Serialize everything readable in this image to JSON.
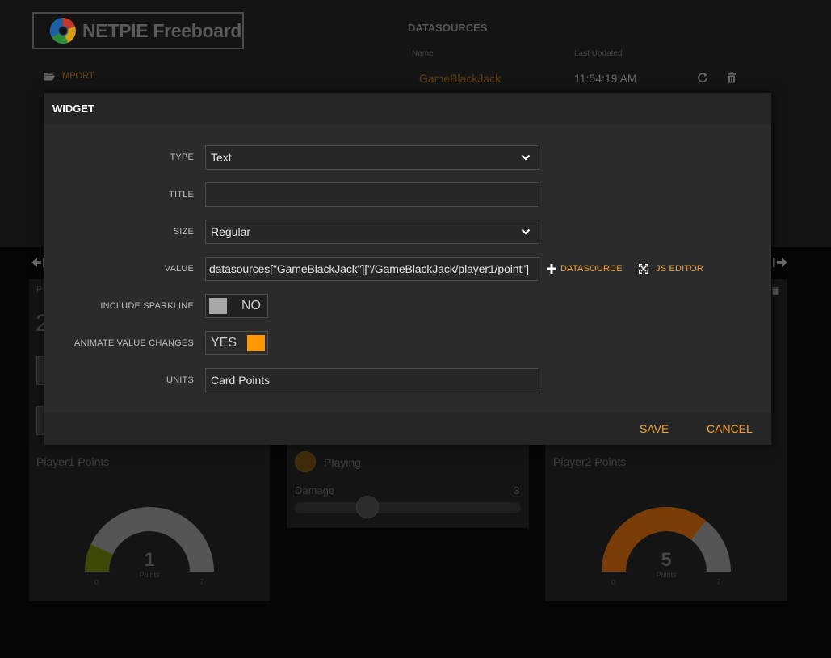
{
  "app": {
    "title": "NETPIE Freeboard"
  },
  "header": {
    "import_label": "IMPORT",
    "datasources": {
      "heading": "DATASOURCES",
      "columns": [
        "Name",
        "Last Updated"
      ],
      "rows": [
        {
          "name": "GameBlackJack",
          "last_updated": "11:54:19 AM"
        }
      ]
    }
  },
  "panes": {
    "left": {
      "title": "Player1 Points",
      "gauge": {
        "value": "1",
        "units": "Points",
        "min": "0",
        "max": "7",
        "fraction": 0.14
      }
    },
    "middle": {
      "indicator_label": "Playing",
      "slider_label": "Damage",
      "slider_value": "3",
      "slider_fraction": 0.32
    },
    "right": {
      "title": "Player2 Points",
      "gauge": {
        "value": "5",
        "units": "Points",
        "min": "0",
        "max": "7",
        "fraction": 0.71
      }
    },
    "left_partial_value": "2",
    "left_partial_title": "P"
  },
  "modal": {
    "title": "WIDGET",
    "fields": {
      "type": {
        "label": "TYPE",
        "value": "Text"
      },
      "title": {
        "label": "TITLE",
        "value": ""
      },
      "size": {
        "label": "SIZE",
        "value": "Regular"
      },
      "value": {
        "label": "VALUE",
        "value": "datasources[\"GameBlackJack\"][\"/GameBlackJack/player1/point\"]"
      },
      "sparkline": {
        "label": "INCLUDE SPARKLINE",
        "state": "NO"
      },
      "animate": {
        "label": "ANIMATE VALUE CHANGES",
        "state": "YES"
      },
      "units": {
        "label": "UNITS",
        "value": "Card Points"
      }
    },
    "actions": {
      "datasource": "DATASOURCE",
      "js_editor": "JS EDITOR"
    },
    "footer": {
      "save": "SAVE",
      "cancel": "CANCEL"
    }
  },
  "colors": {
    "accent": "#f0a43a",
    "toggle_on": "#ff9800",
    "toggle_off": "#a8a8a8"
  }
}
